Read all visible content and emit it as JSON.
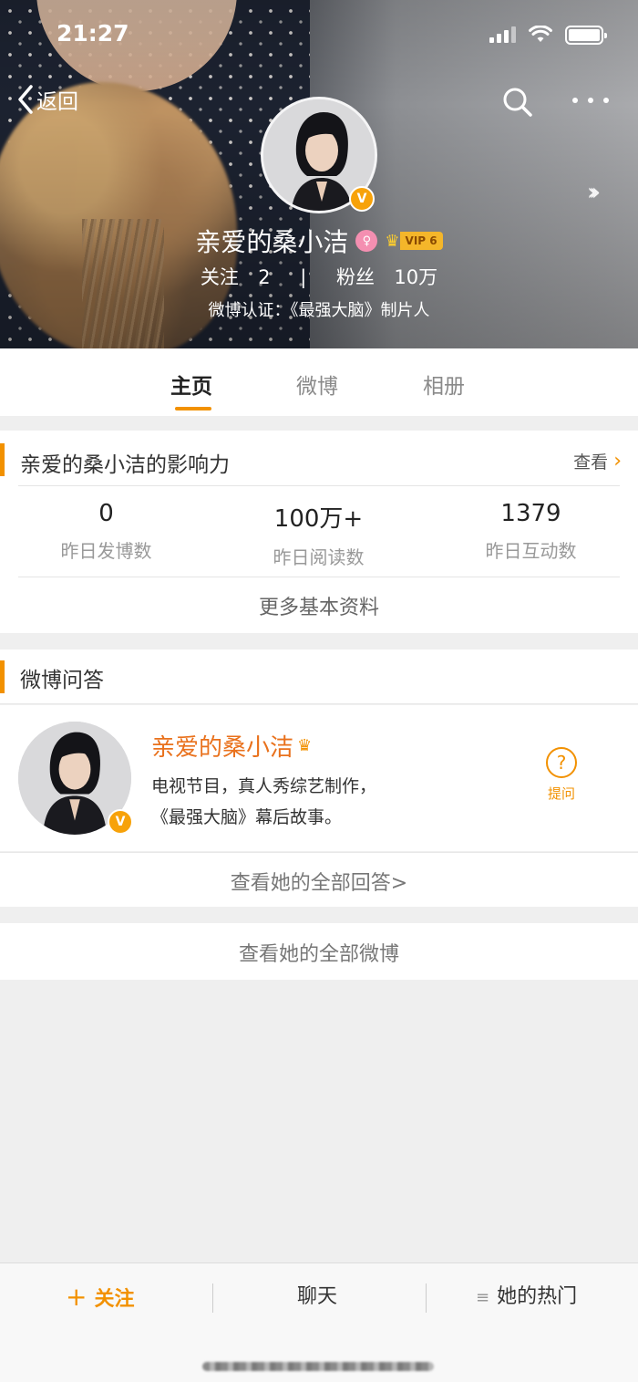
{
  "status_bar": {
    "time": "21:27"
  },
  "nav": {
    "back_label": "返回"
  },
  "profile": {
    "name": "亲爱的桑小洁",
    "vip_label": "VIP 6",
    "follow_label": "关注",
    "follow_count": "2",
    "separator": "|",
    "fans_label": "粉丝",
    "fans_count": "10万",
    "verification": "微博认证：《最强大脑》制片人"
  },
  "tabs": [
    {
      "label": "主页",
      "active": true
    },
    {
      "label": "微博",
      "active": false
    },
    {
      "label": "相册",
      "active": false
    }
  ],
  "influence": {
    "title": "亲爱的桑小洁的影响力",
    "view_label": "查看",
    "stats": [
      {
        "value": "0",
        "label": "昨日发博数"
      },
      {
        "value": "100万+",
        "label": "昨日阅读数"
      },
      {
        "value": "1379",
        "label": "昨日互动数"
      }
    ],
    "more_info": "更多基本资料"
  },
  "qa": {
    "title": "微博问答",
    "name": "亲爱的桑小洁",
    "desc_line1": "电视节目，真人秀综艺制作，",
    "desc_line2": "《最强大脑》幕后故事。",
    "ask_label": "提问",
    "all_answers": "查看她的全部回答>"
  },
  "all_weibo": "查看她的全部微博",
  "bottom_bar": {
    "follow": "关注",
    "chat": "聊天",
    "hot": "她的热门"
  },
  "colors": {
    "accent": "#f29100",
    "name_orange": "#e9711c",
    "verified_badge": "#f7a20a"
  },
  "icons": [
    "back-chevron-icon",
    "search-icon",
    "more-icon",
    "expand-icon",
    "verified-icon",
    "female-icon",
    "vip-crown-icon",
    "question-icon",
    "plus-icon",
    "menu-icon"
  ]
}
